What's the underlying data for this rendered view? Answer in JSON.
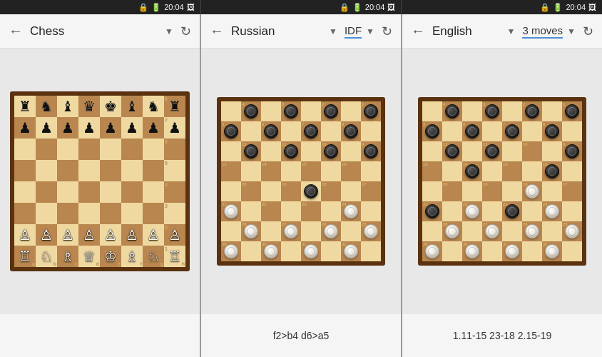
{
  "statusBar": {
    "time": "20:04",
    "icons": [
      "battery",
      "signal",
      "photo"
    ]
  },
  "panels": [
    {
      "id": "chess",
      "title": "Chess",
      "hasDropdownArrow": true,
      "secondDropdown": null,
      "moveText": "",
      "boardType": "chess"
    },
    {
      "id": "russian",
      "title": "Russian",
      "hasDropdownArrow": true,
      "secondDropdown": "IDF",
      "moveText": "f2>b4 d6>a5",
      "boardType": "checkers-russian"
    },
    {
      "id": "english",
      "title": "English",
      "hasDropdownArrow": true,
      "secondDropdown": "3 moves",
      "moveText": "1.11-15 23-18 2.15-19",
      "boardType": "checkers-english"
    }
  ],
  "labels": {
    "back_arrow": "←",
    "refresh": "↻",
    "dropdown_arrow": "▾"
  }
}
